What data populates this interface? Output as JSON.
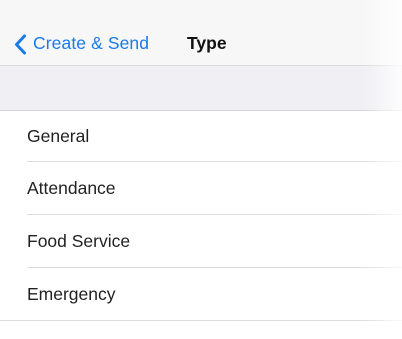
{
  "navbar": {
    "back_label": "Create & Send",
    "title": "Type",
    "back_icon": "chevron-left-icon",
    "accent_color": "#1a7ae6"
  },
  "type_list": {
    "items": [
      {
        "label": "General"
      },
      {
        "label": "Attendance"
      },
      {
        "label": "Food Service"
      },
      {
        "label": "Emergency"
      }
    ]
  }
}
